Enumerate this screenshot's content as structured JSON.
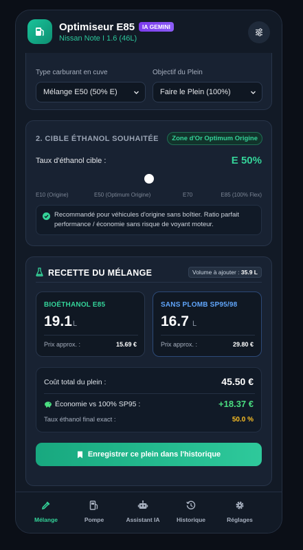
{
  "header": {
    "title": "Optimiseur E85",
    "ai_badge": "IA GEMINI",
    "subtitle": "Nissan Note I 1.6 (46L)"
  },
  "config": {
    "fuel_in_tank_label": "Type carburant en cuve",
    "fuel_in_tank_value": "Mélange E50 (50% E)",
    "goal_label": "Objectif du Plein",
    "goal_value": "Faire le Plein (100%)"
  },
  "target": {
    "section_title": "2. CIBLE ÉTHANOL SOUHAITÉE",
    "zone_badge": "Zone d'Or Optimum Origine",
    "label": "Taux d'éthanol cible :",
    "value": "E 50%",
    "slider_fraction": 0.5,
    "ticks": [
      "E10 (Origine)",
      "E50 (Optimum Origine)",
      "E70",
      "E85 (100% Flex)"
    ],
    "info": "Recommandé pour véhicules d'origine sans boîtier. Ratio parfait performance / économie sans risque de voyant moteur."
  },
  "recipe": {
    "title": "RECETTE DU MÉLANGE",
    "volume_label": "Volume à ajouter :",
    "volume_value": "35.9 L",
    "e85": {
      "name": "BIOÉTHANOL E85",
      "qty": "19.1",
      "unit": "L",
      "price_label": "Prix approx. :",
      "price": "15.69 €"
    },
    "sp": {
      "name": "SANS PLOMB SP95/98",
      "qty": "16.7",
      "unit": "L",
      "price_label": "Prix approx. :",
      "price": "29.80 €"
    },
    "total_label": "Coût total du plein :",
    "total_value": "45.50 €",
    "savings_label": "Économie vs 100% SP95 :",
    "savings_value": "+18.37 €",
    "ethanol_label": "Taux éthanol final exact :",
    "ethanol_value": "50.0 %",
    "save_button": "Enregistrer ce plein dans l'historique"
  },
  "nav": [
    {
      "label": "Mélange"
    },
    {
      "label": "Pompe"
    },
    {
      "label": "Assistant IA"
    },
    {
      "label": "Historique"
    },
    {
      "label": "Réglages"
    }
  ],
  "colors": {
    "accent": "#34d399",
    "e85": "#34d399",
    "sp": "#60a5fa",
    "savings": "#4ade80",
    "ethanol": "#fbbf24",
    "ai_badge": "#8b5cf6"
  }
}
